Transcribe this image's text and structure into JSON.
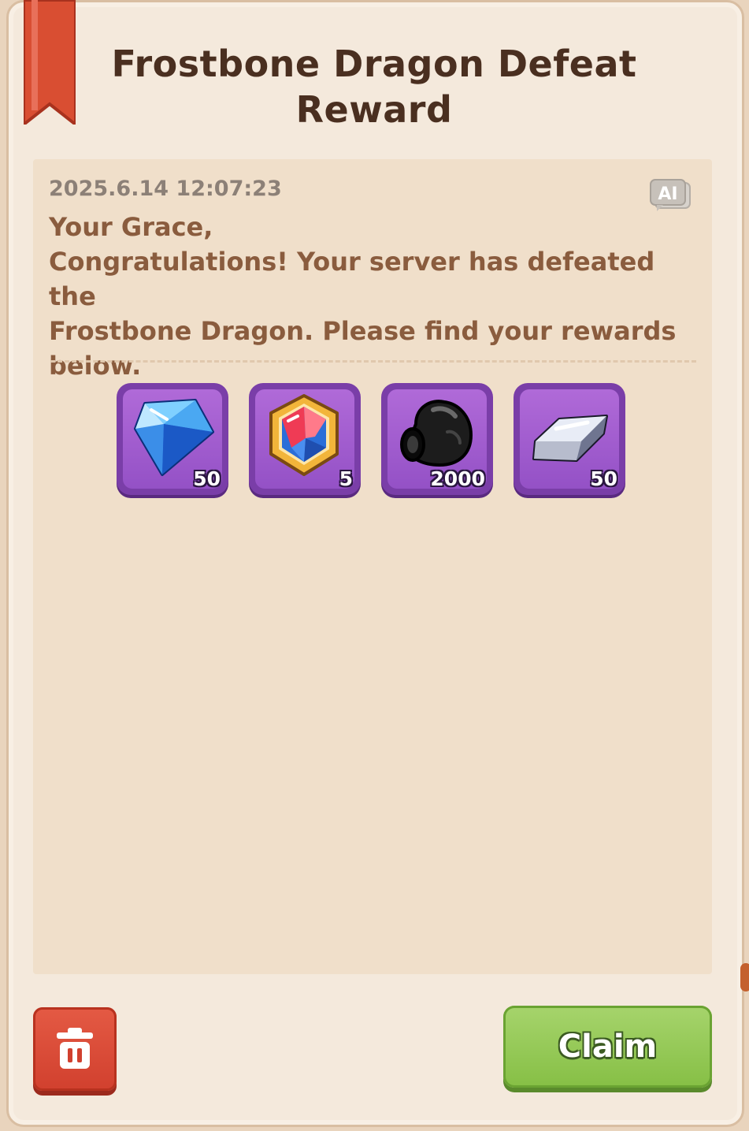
{
  "mail": {
    "title": "Frostbone Dragon Defeat Reward",
    "timestamp": "2025.6.14  12:07:23",
    "ai_badge": "AI",
    "message_lines": [
      "Your Grace,",
      "Congratulations! Your server has defeated the",
      "Frostbone Dragon. Please find your rewards",
      "below."
    ]
  },
  "rewards": [
    {
      "icon": "blue-diamond-icon",
      "quantity": "50"
    },
    {
      "icon": "crystal-badge-icon",
      "quantity": "5"
    },
    {
      "icon": "black-ore-icon",
      "quantity": "2000"
    },
    {
      "icon": "silver-ingot-icon",
      "quantity": "50"
    }
  ],
  "actions": {
    "delete_icon": "trash-icon",
    "claim_label": "Claim"
  },
  "colors": {
    "title": "#4a2f20",
    "message": "#8a5c3e",
    "reward_frame": "#7a3ea8",
    "delete_button": "#d1402e",
    "claim_button": "#86bf45",
    "ribbon": "#d94e32"
  }
}
